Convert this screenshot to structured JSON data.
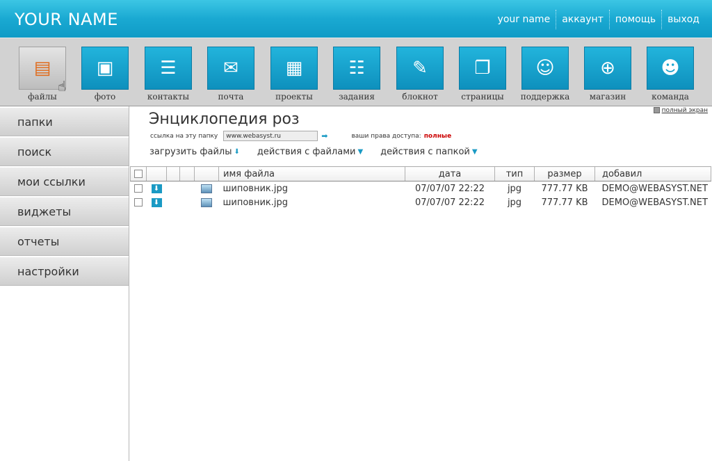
{
  "header": {
    "brand": "YOUR NAME",
    "nav": [
      "your name",
      "аккаунт",
      "помощь",
      "выход"
    ]
  },
  "apps": [
    {
      "label": "файлы",
      "icon": "folders-icon",
      "glyph": "▤",
      "active": true
    },
    {
      "label": "фото",
      "icon": "photo-icon",
      "glyph": "▣"
    },
    {
      "label": "контакты",
      "icon": "contacts-icon",
      "glyph": "☰"
    },
    {
      "label": "почта",
      "icon": "mail-icon",
      "glyph": "✉"
    },
    {
      "label": "проекты",
      "icon": "projects-icon",
      "glyph": "▦"
    },
    {
      "label": "задания",
      "icon": "tasks-icon",
      "glyph": "☷"
    },
    {
      "label": "блокнот",
      "icon": "notepad-icon",
      "glyph": "✎"
    },
    {
      "label": "страницы",
      "icon": "pages-icon",
      "glyph": "❐"
    },
    {
      "label": "поддержка",
      "icon": "support-icon",
      "glyph": "☺"
    },
    {
      "label": "магазин",
      "icon": "shop-cart-icon",
      "glyph": "⊕"
    },
    {
      "label": "команда",
      "icon": "team-icon",
      "glyph": "☻"
    }
  ],
  "sidebar": {
    "items": [
      "папки",
      "поиск",
      "мои ссылки",
      "виджеты",
      "отчеты",
      "настройки"
    ]
  },
  "main": {
    "fullscreen_label": "полный экран",
    "title": "Энциклопедия роз",
    "link_label": "ссылка на эту папку",
    "link_value": "www.webasyst.ru",
    "rights_label": "ваши права доступа:",
    "rights_value": "полные",
    "actions": [
      "загрузить файлы",
      "действия с файлами",
      "действия с папкой"
    ]
  },
  "table": {
    "headers": {
      "name": "имя файла",
      "date": "дата",
      "type": "тип",
      "size": "размер",
      "added": "добавил"
    },
    "rows": [
      {
        "name": "шиповник.jpg",
        "date": "07/07/07 22:22",
        "type": "jpg",
        "size": "777.77 KB",
        "added": "DEMO@WEBASYST.NET"
      },
      {
        "name": "шиповник.jpg",
        "date": "07/07/07 22:22",
        "type": "jpg",
        "size": "777.77 KB",
        "added": "DEMO@WEBASYST.NET"
      }
    ]
  },
  "colors": {
    "header_blue": "#1aa9d2",
    "tile_blue": "#0e90bd",
    "rights_red": "#cc0000"
  }
}
